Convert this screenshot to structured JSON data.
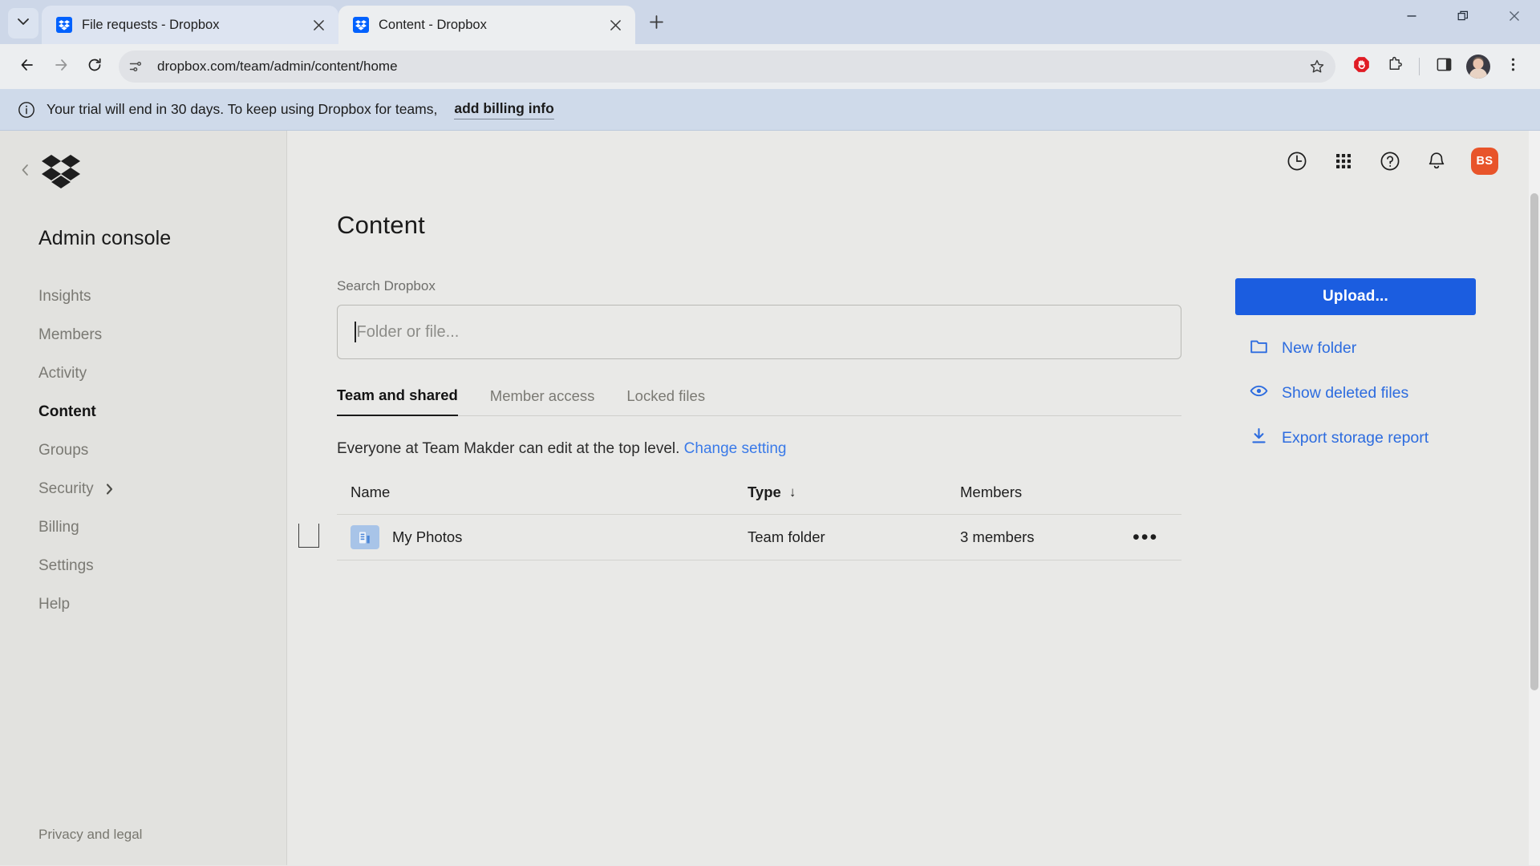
{
  "browser": {
    "tab_list_icon": "chevron-down-icon",
    "tabs": [
      {
        "title": "File requests - Dropbox",
        "favicon": "dropbox-favicon",
        "active": false
      },
      {
        "title": "Content - Dropbox",
        "favicon": "dropbox-favicon",
        "active": true
      }
    ],
    "new_tab_icon": "plus-icon",
    "window_controls": [
      "minimize-icon",
      "restore-icon",
      "close-icon"
    ],
    "nav": {
      "back_icon": "back-arrow-icon",
      "forward_icon": "forward-arrow-icon",
      "reload_icon": "reload-icon"
    },
    "omnibox": {
      "site_info_icon": "site-settings-icon",
      "url": "dropbox.com/team/admin/content/home",
      "bookmark_icon": "star-icon"
    },
    "toolbar_icons": [
      "adblock-icon",
      "extensions-icon",
      "side-panel-icon",
      "profile-avatar",
      "chrome-menu-icon"
    ]
  },
  "banner": {
    "icon": "info-icon",
    "text": "Your trial will end in 30 days. To keep using Dropbox for teams,",
    "link": "add billing info"
  },
  "sidebar": {
    "collapse_icon": "chevron-left-icon",
    "logo_icon": "dropbox-logo-icon",
    "title": "Admin console",
    "items": [
      {
        "label": "Insights",
        "active": false,
        "chevron": false
      },
      {
        "label": "Members",
        "active": false,
        "chevron": false
      },
      {
        "label": "Activity",
        "active": false,
        "chevron": false
      },
      {
        "label": "Content",
        "active": true,
        "chevron": false
      },
      {
        "label": "Groups",
        "active": false,
        "chevron": false
      },
      {
        "label": "Security",
        "active": false,
        "chevron": true
      },
      {
        "label": "Billing",
        "active": false,
        "chevron": false
      },
      {
        "label": "Settings",
        "active": false,
        "chevron": false
      },
      {
        "label": "Help",
        "active": false,
        "chevron": false
      }
    ],
    "footer": "Privacy and legal"
  },
  "topbar": {
    "icons": [
      "history-clock-icon",
      "apps-grid-icon",
      "help-question-icon",
      "notifications-bell-icon"
    ],
    "avatar_initials": "BS",
    "avatar_color": "#e8542a"
  },
  "main": {
    "page_title": "Content",
    "search": {
      "label": "Search Dropbox",
      "value": "",
      "placeholder": "Folder or file..."
    },
    "tabs": [
      {
        "label": "Team and shared",
        "active": true
      },
      {
        "label": "Member access",
        "active": false
      },
      {
        "label": "Locked files",
        "active": false
      }
    ],
    "permission": {
      "text": "Everyone at Team Makder can edit at the top level.",
      "link": "Change setting"
    },
    "table": {
      "columns": [
        {
          "label": "Name",
          "sorted": false
        },
        {
          "label": "Type",
          "sorted": true,
          "sort_arrow": "↓"
        },
        {
          "label": "Members",
          "sorted": false
        }
      ],
      "rows": [
        {
          "name": "My Photos",
          "icon": "team-folder-icon",
          "type": "Team folder",
          "members": "3 members",
          "actions_icon": "more-options-icon",
          "actions_label": "•••",
          "checked": false
        }
      ]
    }
  },
  "actions": {
    "upload_label": "Upload...",
    "upload_color": "#1b5de0",
    "items": [
      {
        "label": "New folder",
        "icon": "folder-icon"
      },
      {
        "label": "Show deleted files",
        "icon": "eye-icon"
      },
      {
        "label": "Export storage report",
        "icon": "download-icon"
      }
    ]
  }
}
